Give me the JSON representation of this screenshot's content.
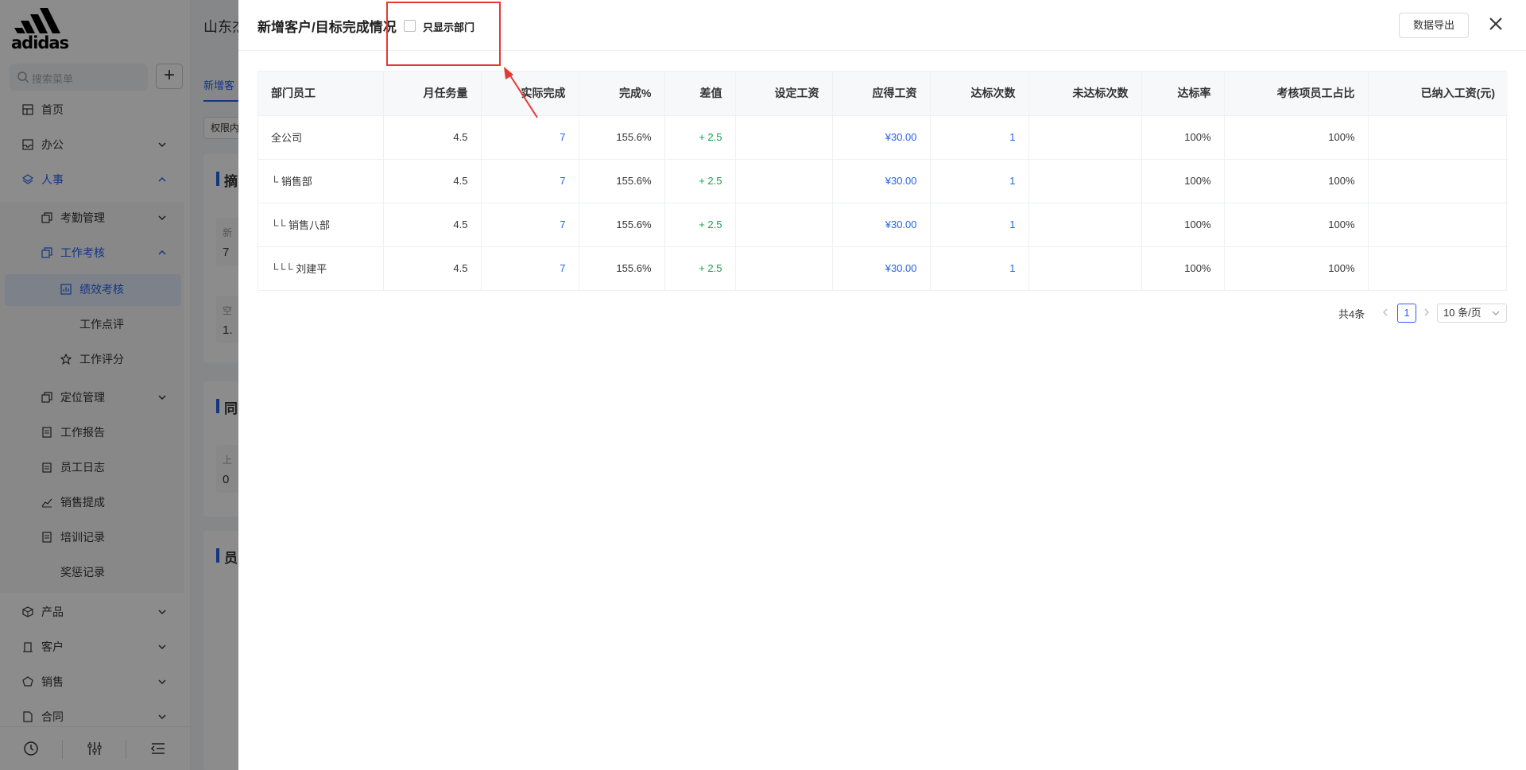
{
  "brand": {
    "logo_text": "adidas"
  },
  "sidebar": {
    "search_placeholder": "搜索菜单",
    "add_label": "+",
    "items": [
      {
        "label": "首页",
        "icon": "home-icon"
      },
      {
        "label": "办公",
        "icon": "inbox-icon"
      },
      {
        "label": "人事",
        "icon": "layers-icon"
      },
      {
        "label": "考勤管理",
        "icon": "copy-icon"
      },
      {
        "label": "工作考核",
        "icon": "copy-icon"
      },
      {
        "label": "绩效考核",
        "icon": "report-icon"
      },
      {
        "label": "工作点评"
      },
      {
        "label": "工作评分",
        "icon": "star-icon"
      },
      {
        "label": "定位管理",
        "icon": "copy-icon"
      },
      {
        "label": "工作报告",
        "icon": "doc-icon"
      },
      {
        "label": "员工日志",
        "icon": "calendar-icon"
      },
      {
        "label": "销售提成",
        "icon": "chart-icon"
      },
      {
        "label": "培训记录",
        "icon": "doc-icon"
      },
      {
        "label": "奖惩记录"
      },
      {
        "label": "产品",
        "icon": "cube-icon"
      },
      {
        "label": "客户",
        "icon": "building-icon"
      },
      {
        "label": "销售",
        "icon": "tag-icon"
      },
      {
        "label": "合同",
        "icon": "file-icon"
      }
    ],
    "footer_icons": [
      "history-icon",
      "sliders-icon",
      "collapse-icon"
    ]
  },
  "background_page": {
    "company": "山东杰",
    "tab": "新增客",
    "filter": "权限内",
    "cards": [
      "摘",
      "同",
      "员"
    ],
    "inner": [
      {
        "label": "新",
        "value": "7"
      },
      {
        "label": "空",
        "value": "1."
      },
      {
        "label": "上",
        "value": "0"
      }
    ]
  },
  "drawer": {
    "title": "新增客户/目标完成情况",
    "checkbox_label": "只显示部门",
    "export_label": "数据导出",
    "columns": [
      "部门员工",
      "月任务量",
      "实际完成",
      "完成%",
      "差值",
      "设定工资",
      "应得工资",
      "达标次数",
      "未达标次数",
      "达标率",
      "考核项员工占比",
      "已纳入工资(元)"
    ],
    "rows": [
      {
        "name": "全公司",
        "task": "4.5",
        "actual": "7",
        "pct": "155.6%",
        "diff": "+ 2.5",
        "set_salary": "",
        "due_salary": "¥30.00",
        "hit": "1",
        "miss": "",
        "rate": "100%",
        "ratio": "100%",
        "included": ""
      },
      {
        "name": "└ 销售部",
        "task": "4.5",
        "actual": "7",
        "pct": "155.6%",
        "diff": "+ 2.5",
        "set_salary": "",
        "due_salary": "¥30.00",
        "hit": "1",
        "miss": "",
        "rate": "100%",
        "ratio": "100%",
        "included": ""
      },
      {
        "name": "└└ 销售八部",
        "task": "4.5",
        "actual": "7",
        "pct": "155.6%",
        "diff": "+ 2.5",
        "set_salary": "",
        "due_salary": "¥30.00",
        "hit": "1",
        "miss": "",
        "rate": "100%",
        "ratio": "100%",
        "included": ""
      },
      {
        "name": "└└└ 刘建平",
        "task": "4.5",
        "actual": "7",
        "pct": "155.6%",
        "diff": "+ 2.5",
        "set_salary": "",
        "due_salary": "¥30.00",
        "hit": "1",
        "miss": "",
        "rate": "100%",
        "ratio": "100%",
        "included": ""
      }
    ],
    "pagination": {
      "total": "共4条",
      "page": "1",
      "page_size": "10 条/页"
    }
  },
  "colors": {
    "primary": "#2563eb",
    "positive": "#16a34a",
    "annotation": "#e53935"
  }
}
